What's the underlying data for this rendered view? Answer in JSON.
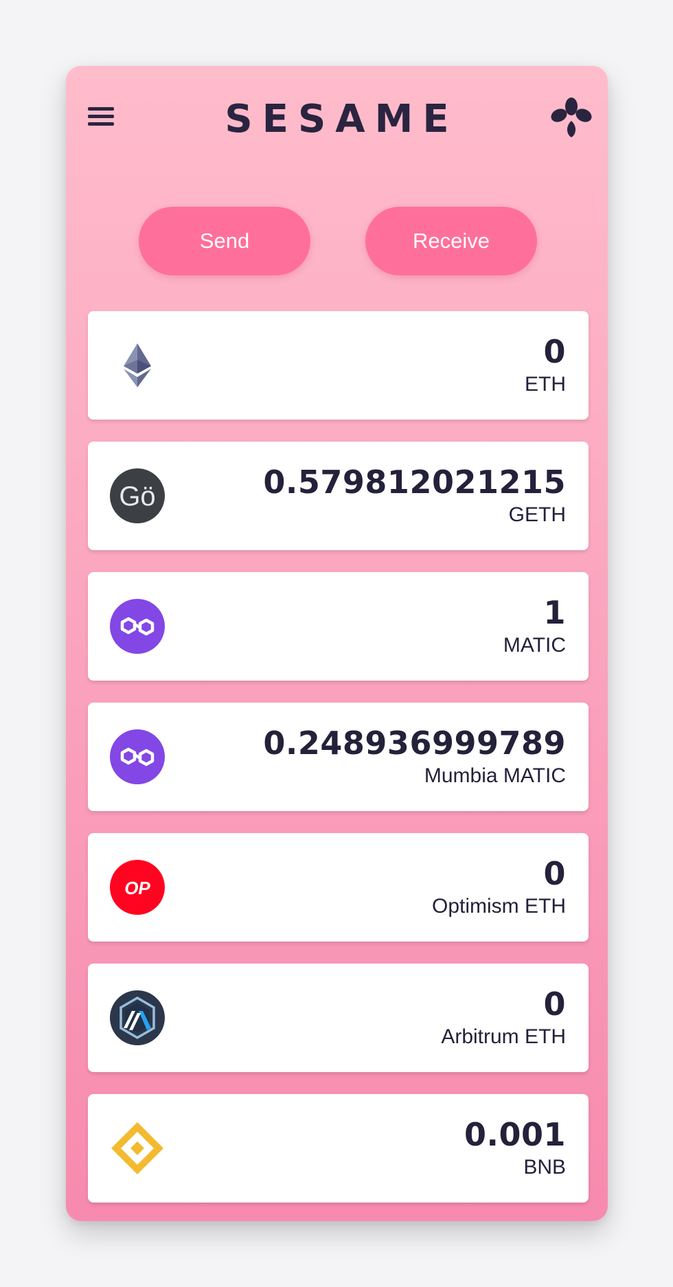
{
  "app": {
    "title": "SESAME"
  },
  "header": {
    "menu_icon": "hamburger-menu-icon",
    "network_icon": "sesame-seeds-icon"
  },
  "actions": {
    "send_label": "Send",
    "receive_label": "Receive"
  },
  "colors": {
    "background_top": "#ffbccb",
    "background_bottom": "#f78aae",
    "button": "#ff6f9c",
    "text_dark": "#24213a"
  },
  "tokens": [
    {
      "amount": "0",
      "symbol": "ETH",
      "icon": "ethereum-icon"
    },
    {
      "amount": "0.579812021215",
      "symbol": "GETH",
      "icon": "goerli-icon",
      "icon_text": "Gö"
    },
    {
      "amount": "1",
      "symbol": "MATIC",
      "icon": "polygon-icon"
    },
    {
      "amount": "0.248936999789",
      "symbol": "Mumbia MATIC",
      "icon": "polygon-icon"
    },
    {
      "amount": "0",
      "symbol": "Optimism ETH",
      "icon": "optimism-icon",
      "icon_text": "OP"
    },
    {
      "amount": "0",
      "symbol": "Arbitrum ETH",
      "icon": "arbitrum-icon"
    },
    {
      "amount": "0.001",
      "symbol": "BNB",
      "icon": "binance-icon"
    }
  ]
}
